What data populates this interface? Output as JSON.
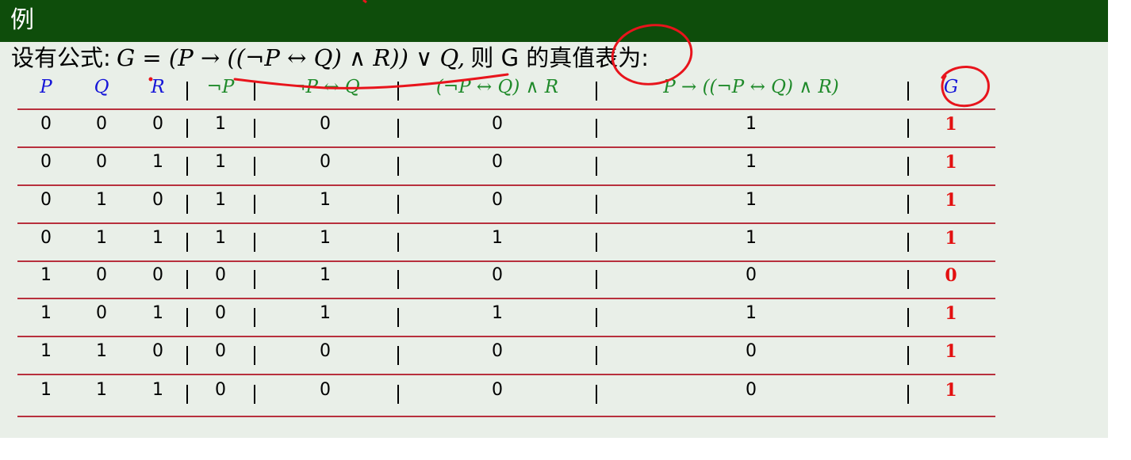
{
  "slide": {
    "title": "例",
    "intro_prefix": "设有公式:",
    "formula": "G = (P → ((¬P ↔ Q) ∧ R)) ∨ Q,",
    "intro_suffix": "则 G 的真值表为:"
  },
  "truth_table": {
    "headers": [
      "P",
      "Q",
      "R",
      "¬P",
      "¬P ↔ Q",
      "(¬P ↔ Q) ∧ R",
      "P → ((¬P ↔ Q) ∧ R)",
      "G"
    ],
    "rows": [
      [
        "0",
        "0",
        "0",
        "1",
        "0",
        "0",
        "1",
        "1"
      ],
      [
        "0",
        "0",
        "1",
        "1",
        "0",
        "0",
        "1",
        "1"
      ],
      [
        "0",
        "1",
        "0",
        "1",
        "1",
        "0",
        "1",
        "1"
      ],
      [
        "0",
        "1",
        "1",
        "1",
        "1",
        "1",
        "1",
        "1"
      ],
      [
        "1",
        "0",
        "0",
        "0",
        "1",
        "0",
        "0",
        "0"
      ],
      [
        "1",
        "0",
        "1",
        "0",
        "1",
        "1",
        "1",
        "1"
      ],
      [
        "1",
        "1",
        "0",
        "0",
        "0",
        "0",
        "0",
        "1"
      ],
      [
        "1",
        "1",
        "1",
        "0",
        "0",
        "0",
        "0",
        "1"
      ]
    ]
  },
  "colors": {
    "title_bar": "#0e4d0b",
    "background": "#e9efe8",
    "variable_header": "#1616d8",
    "formula_header": "#1f8a2a",
    "result_value": "#e31010",
    "rule": "#b8303d",
    "annotation_ink": "#e8141c"
  }
}
